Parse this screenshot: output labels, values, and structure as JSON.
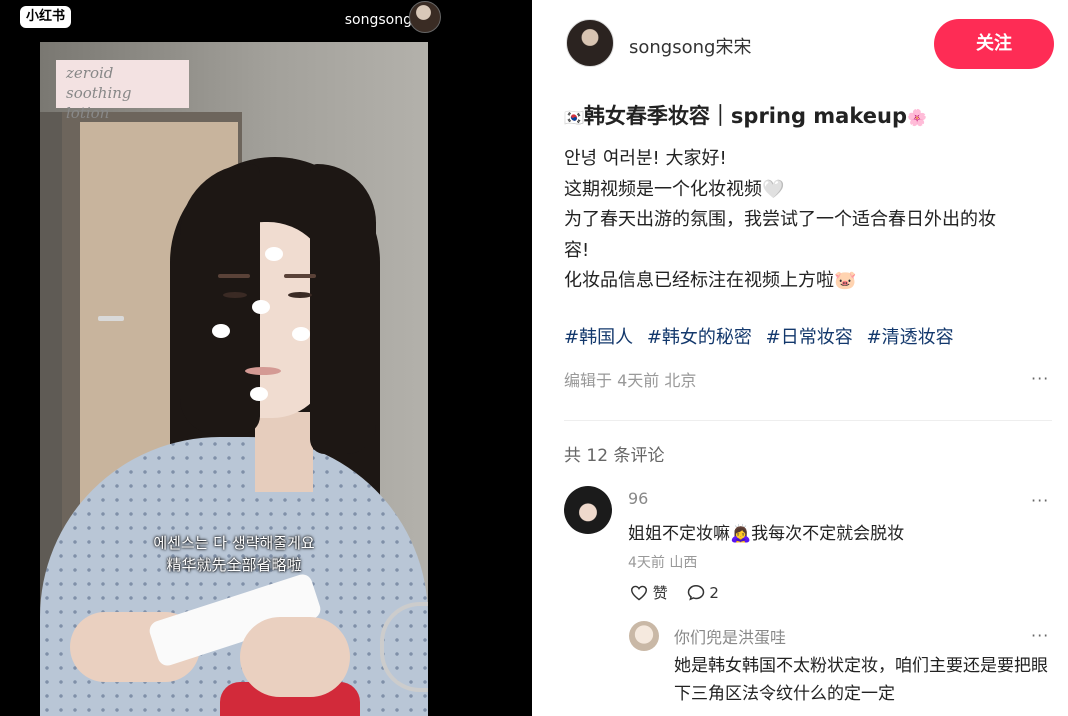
{
  "video": {
    "app_logo": "小红书",
    "author": "songsong宋宋",
    "product_label": [
      "zeroid",
      "soothing lotion"
    ],
    "subtitle_ko": "에센스는 다 생략해줄게요",
    "subtitle_zh": "精华就先全部省略啦"
  },
  "header": {
    "author": "songsong宋宋",
    "follow_label": "关注"
  },
  "post": {
    "flag": "🇰🇷",
    "title": "韩女春季妆容｜spring makeup",
    "title_emoji": "🌸",
    "lines": [
      "안녕 여러분! 大家好!",
      "这期视频是一个化妆视频🤍",
      "为了春天出游的氛围，我尝试了一个适合春日外出的妆",
      "容!",
      "化妆品信息已经标注在视频上方啦🐷"
    ],
    "tags": [
      "#韩国人",
      "#韩女的秘密",
      "#日常妆容",
      "#清透妆容"
    ],
    "meta": "编辑于 4天前 北京",
    "more_icon": "···"
  },
  "comments": {
    "count_label": "共 12 条评论",
    "items": [
      {
        "user": "96",
        "text": "姐姐不定妆嘛🙇‍♀️我每次不定就会脱妆",
        "meta": "4天前 山西",
        "like_label": "赞",
        "reply_count": "2",
        "more_icon": "···"
      }
    ],
    "reply": {
      "user": "你们兜是洪蛋哇",
      "text": "她是韩女韩国不太粉状定妆，咱们主要还是要把眼下三角区法令纹什么的定一定",
      "more_icon": "···"
    }
  },
  "colors": {
    "follow_bg": "#fe2c55",
    "tag_color": "#13386c"
  }
}
